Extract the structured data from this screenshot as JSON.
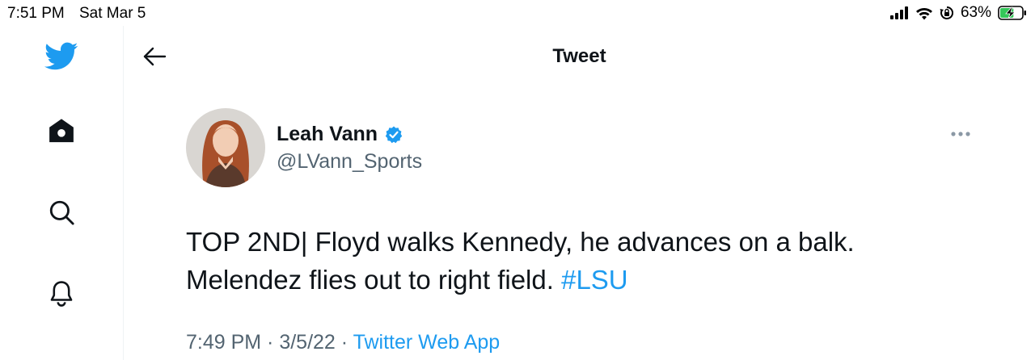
{
  "status_bar": {
    "time": "7:51 PM",
    "date": "Sat Mar 5",
    "battery_percent": "63%",
    "battery_level": 0.63,
    "icons": [
      "cellular-signal-icon",
      "wifi-icon",
      "orientation-lock-icon",
      "battery-charging-icon"
    ]
  },
  "sidebar": {
    "items": [
      {
        "name": "twitter-logo",
        "icon": "twitter-bird-icon"
      },
      {
        "name": "home",
        "icon": "home-icon"
      },
      {
        "name": "explore",
        "icon": "search-icon"
      },
      {
        "name": "notifications",
        "icon": "bell-icon"
      }
    ]
  },
  "header": {
    "title": "Tweet",
    "back_icon": "arrow-left-icon"
  },
  "tweet": {
    "author_name": "Leah Vann",
    "author_handle": "@LVann_Sports",
    "verified": true,
    "text_line1": "TOP 2ND| Floyd walks Kennedy, he advances on a balk.",
    "text_line2": "Melendez flies out to right field.",
    "hashtag": "#LSU",
    "time": "7:49 PM",
    "separator": " · ",
    "date": "3/5/22",
    "source": "Twitter Web App"
  },
  "colors": {
    "accent": "#1d9bf0",
    "text_primary": "#0f1419",
    "text_secondary": "#536471",
    "battery_fill": "#34c759"
  }
}
